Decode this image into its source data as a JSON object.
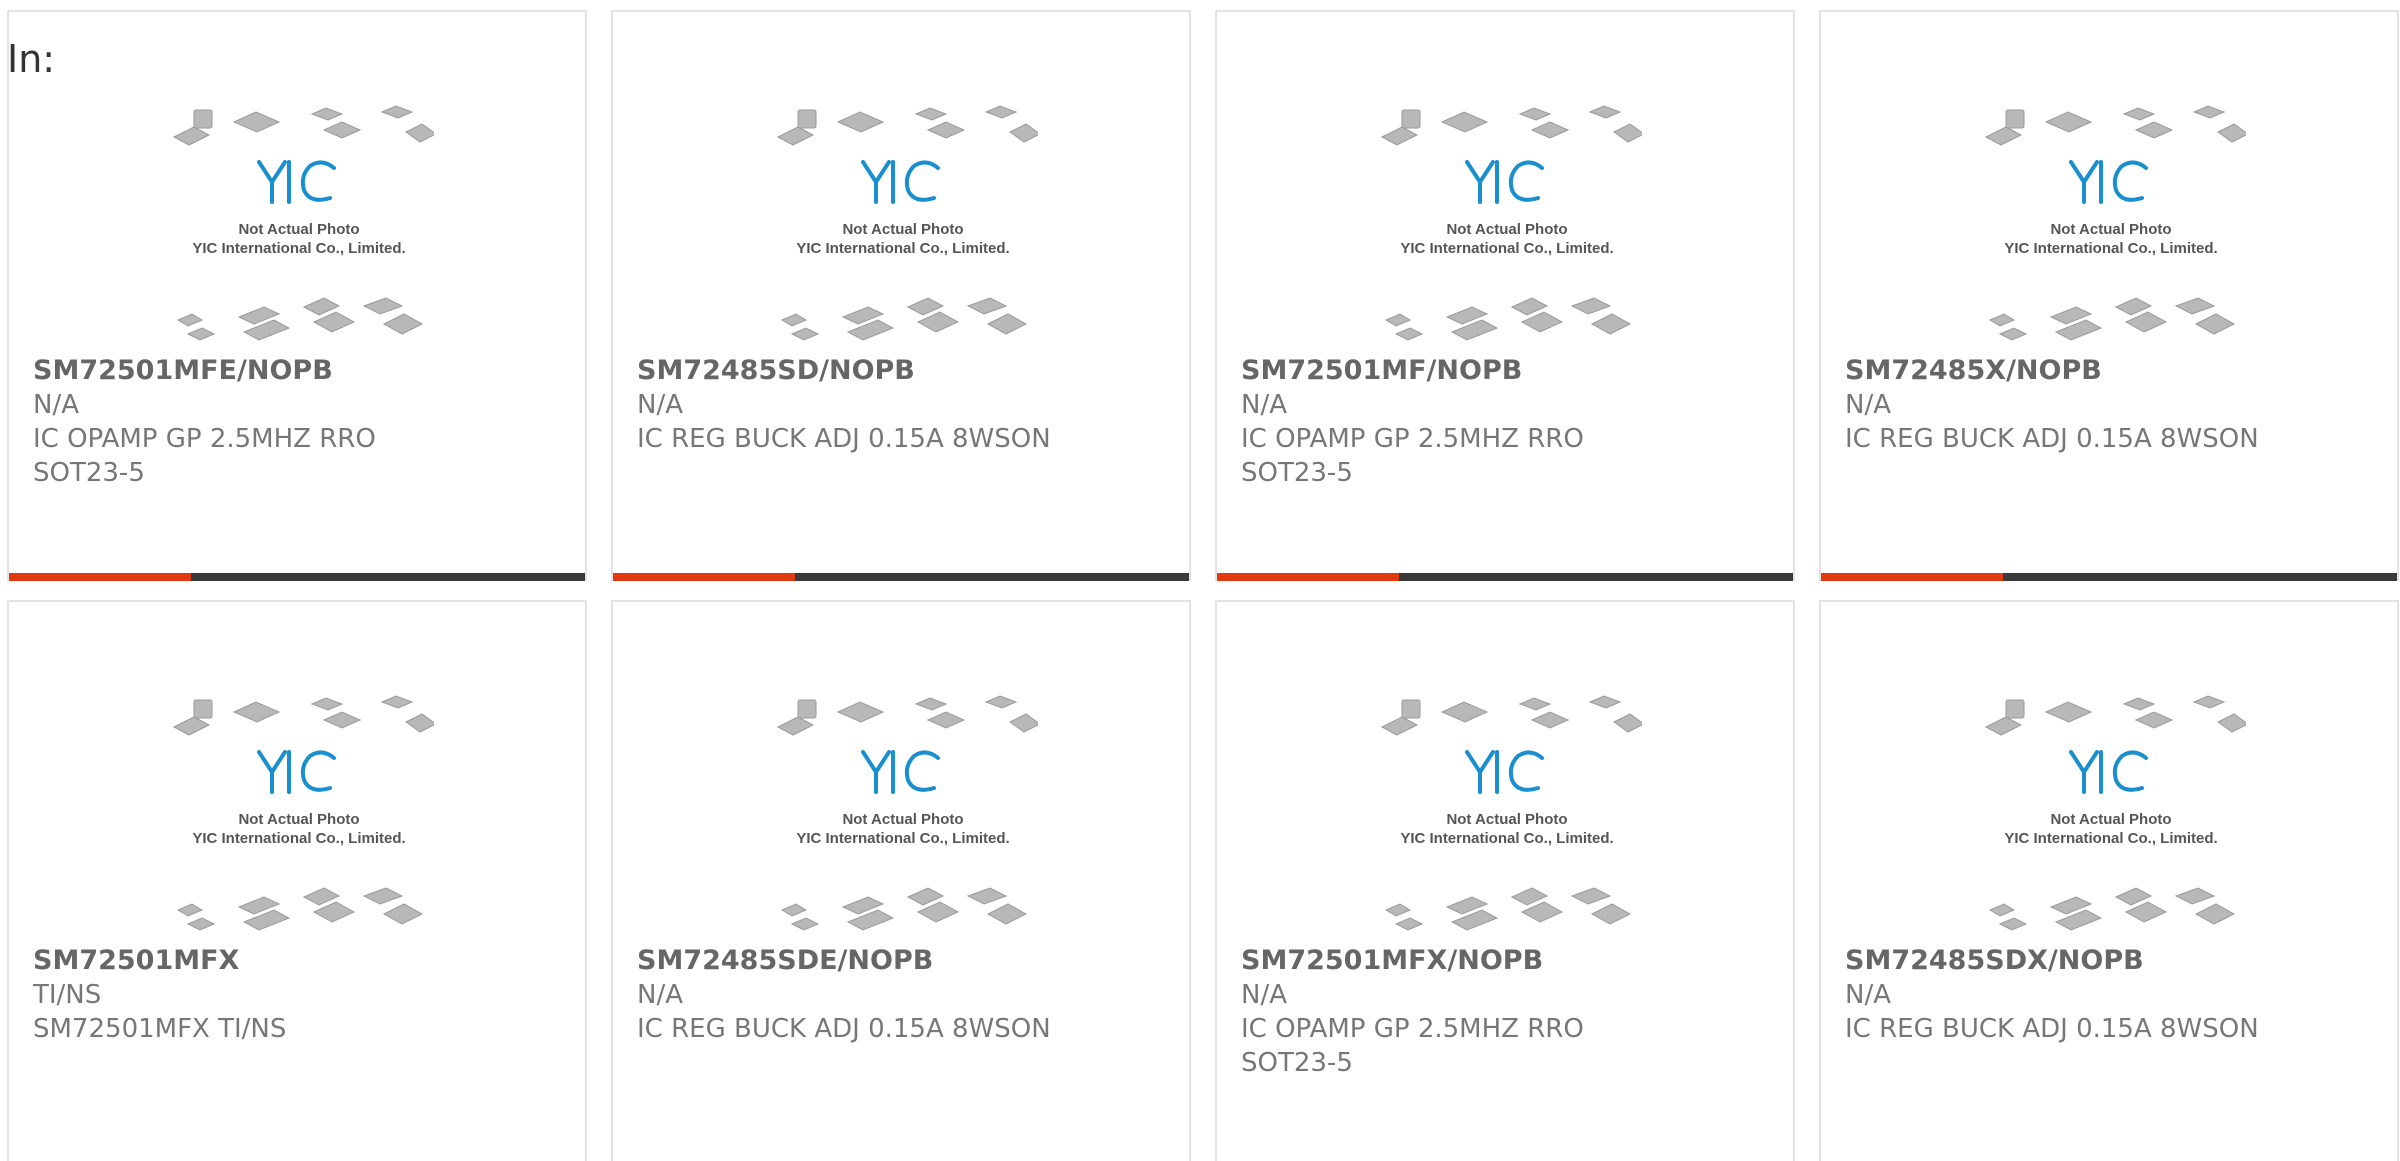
{
  "page": {
    "in_label": "In:"
  },
  "colors": {
    "accent": "#e03a10",
    "bar": "#3a3a3a",
    "logo_blue": "#1a8fd0"
  },
  "placeholder_image": {
    "line1": "Not Actual Photo",
    "line2": "YIC International Co., Limited."
  },
  "products": [
    {
      "part": "SM72501MFE/NOPB",
      "maker": "N/A",
      "desc": "IC OPAMP GP 2.5MHZ RRO SOT23-5"
    },
    {
      "part": "SM72485SD/NOPB",
      "maker": "N/A",
      "desc": "IC REG BUCK ADJ 0.15A 8WSON"
    },
    {
      "part": "SM72501MF/NOPB",
      "maker": "N/A",
      "desc": "IC OPAMP GP 2.5MHZ RRO SOT23-5"
    },
    {
      "part": "SM72485X/NOPB",
      "maker": "N/A",
      "desc": "IC REG BUCK ADJ 0.15A 8WSON"
    },
    {
      "part": "SM72501MFX",
      "maker": "TI/NS",
      "desc": "SM72501MFX TI/NS"
    },
    {
      "part": "SM72485SDE/NOPB",
      "maker": "N/A",
      "desc": "IC REG BUCK ADJ 0.15A 8WSON"
    },
    {
      "part": "SM72501MFX/NOPB",
      "maker": "N/A",
      "desc": "IC OPAMP GP 2.5MHZ RRO SOT23-5"
    },
    {
      "part": "SM72485SDX/NOPB",
      "maker": "N/A",
      "desc": "IC REG BUCK ADJ 0.15A 8WSON"
    }
  ]
}
